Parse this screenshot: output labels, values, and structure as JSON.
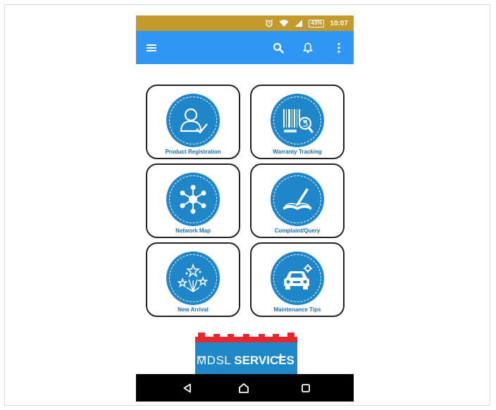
{
  "status_bar": {
    "battery": "43%",
    "time": "10:07",
    "icons": [
      "alarm-icon",
      "wifi-icon",
      "signal-icon",
      "battery-icon"
    ],
    "color": "#c49a2c"
  },
  "app_bar": {
    "color": "#2f97f3",
    "icons": [
      "hamburger-menu-icon",
      "search-icon",
      "bell-icon",
      "more-vert-icon"
    ]
  },
  "tiles": [
    {
      "label": "Product Registration",
      "icon": "user-check-icon"
    },
    {
      "label": "Warranty Tracking",
      "icon": "barcode-search-icon"
    },
    {
      "label": "Network Map",
      "icon": "network-icon"
    },
    {
      "label": "Complaint/Query",
      "icon": "book-pen-icon"
    },
    {
      "label": "New Arrival",
      "icon": "stars-icon"
    },
    {
      "label": "Maintenance Tips",
      "icon": "car-gear-icon"
    }
  ],
  "logo": {
    "minus": "−",
    "plus": "+",
    "brand_part1": "MDSL",
    "brand_part2": "SERVICES",
    "accent": "#e8262d",
    "brand_color": "#1e88c9"
  },
  "nav_bar": {
    "icons": [
      "back-triangle-icon",
      "home-icon",
      "recents-square-icon"
    ]
  }
}
